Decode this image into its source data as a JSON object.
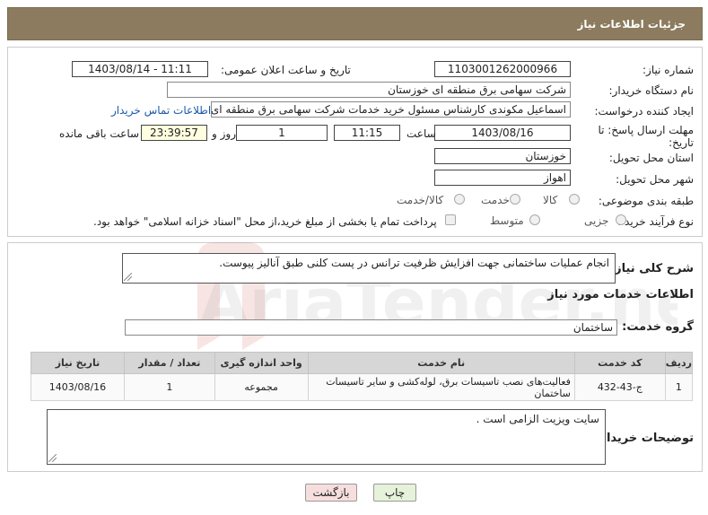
{
  "header": {
    "title": "جزئیات اطلاعات نیاز"
  },
  "fields": {
    "need_number_label": "شماره نیاز:",
    "need_number": "1103001262000966",
    "announce_label": "تاریخ و ساعت اعلان عمومی:",
    "announce_value": "1403/08/14 - 11:11",
    "buyer_org_label": "نام دستگاه خریدار:",
    "buyer_org": "شرکت سهامی برق منطقه ای خوزستان",
    "creator_label": "ایجاد کننده درخواست:",
    "creator": "اسماعیل مکوندی کارشناس مسئول خرید خدمات شرکت سهامی برق منطقه ای",
    "contact_link": "اطلاعات تماس خریدار",
    "deadline_label": "مهلت ارسال پاسخ: تا تاریخ:",
    "deadline_date": "1403/08/16",
    "time_label": "ساعت",
    "deadline_time": "11:15",
    "days_value": "1",
    "days_label": "روز و",
    "remaining_time": "23:39:57",
    "remaining_label": "ساعت باقی مانده",
    "province_label": "استان محل تحویل:",
    "province": "خوزستان",
    "city_label": "شهر محل تحویل:",
    "city": "اهواز",
    "category_label": "طبقه بندی موضوعی:",
    "category_options": [
      "کالا",
      "خدمت",
      "کالا/خدمت"
    ],
    "process_label": "نوع فرآیند خرید :",
    "process_options": [
      "جزیی",
      "متوسط"
    ],
    "payment_note": "پرداخت تمام یا بخشی از مبلغ خرید،از محل \"اسناد خزانه اسلامی\" خواهد بود."
  },
  "summary": {
    "label": "شرح کلی نیاز:",
    "text": "انجام عملیات ساختمانی جهت افزایش ظرفیت ترانس  در پست کلنی طبق آنالیز پیوست."
  },
  "services": {
    "section_title": "اطلاعات خدمات مورد نیاز",
    "group_label": "گروه خدمت:",
    "group_value": "ساختمان",
    "columns": [
      "ردیف",
      "کد خدمت",
      "نام خدمت",
      "واحد اندازه گیری",
      "تعداد / مقدار",
      "تاریخ نیاز"
    ],
    "rows": [
      {
        "row": "1",
        "code": "ج-43-432",
        "name": "فعالیت‌های نصب تاسیسات برق، لوله‌کشی و سایر تاسیسات ساختمان",
        "unit": "مجموعه",
        "qty": "1",
        "date": "1403/08/16"
      }
    ]
  },
  "buyer_notes": {
    "label": "توضیحات خریدار:",
    "text": "سایت ویزیت الزامی است ."
  },
  "buttons": {
    "print": "چاپ",
    "back": "بازگشت"
  },
  "watermark": {
    "text": "AriaTender.neT"
  },
  "colors": {
    "header_bg": "#8c7b5e",
    "link": "#1a5aa8",
    "print_bg": "#e6f2d9",
    "back_bg": "#f7dede"
  }
}
